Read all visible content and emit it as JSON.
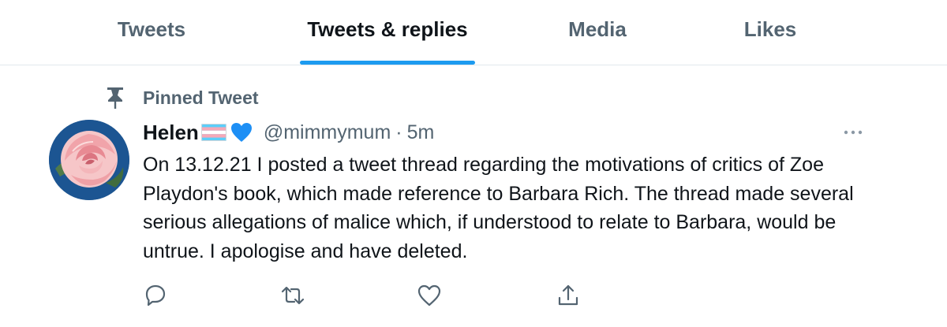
{
  "tabs": [
    {
      "label": "Tweets",
      "active": false
    },
    {
      "label": "Tweets & replies",
      "active": true
    },
    {
      "label": "Media",
      "active": false
    },
    {
      "label": "Likes",
      "active": false
    }
  ],
  "colors": {
    "accent": "#1d9bf0",
    "text_primary": "#0f1419",
    "text_secondary": "#536471",
    "divider": "#e1e8ed"
  },
  "pinned": {
    "label": "Pinned Tweet",
    "icon": "pin-icon"
  },
  "tweet": {
    "author_name": "Helen",
    "name_emojis": [
      "transgender-flag-icon",
      "blue-heart-icon"
    ],
    "handle": "@mimmymum",
    "separator": "·",
    "time": "5m",
    "avatar": "pink-rose-avatar",
    "text": "On 13.12.21 I posted a tweet thread regarding the motivations of critics of Zoe Playdon's book, which made reference to Barbara Rich. The thread made several serious allegations of malice which, if understood to relate to Barbara, would be untrue. I apologise and have deleted.",
    "more_icon": "more-options-icon",
    "actions": [
      "reply-icon",
      "retweet-icon",
      "like-icon",
      "share-icon"
    ]
  }
}
